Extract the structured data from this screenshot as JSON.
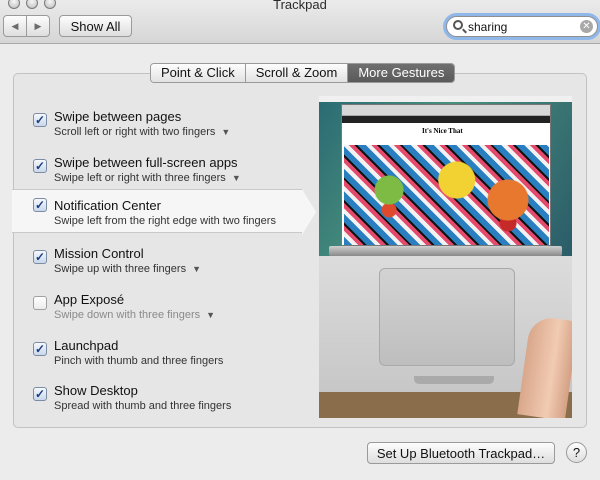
{
  "window": {
    "title": "Trackpad"
  },
  "toolbar": {
    "back": "◀",
    "forward": "▶",
    "show_all": "Show All",
    "search_value": "sharing",
    "search_clear": "✕"
  },
  "tabs": [
    {
      "label": "Point & Click",
      "active": false
    },
    {
      "label": "Scroll & Zoom",
      "active": false
    },
    {
      "label": "More Gestures",
      "active": true
    }
  ],
  "gestures": [
    {
      "title": "Swipe between pages",
      "subtitle": "Scroll left or right with two fingers",
      "checked": true,
      "dropdown": true
    },
    {
      "title": "Swipe between full-screen apps",
      "subtitle": "Swipe left or right with three fingers",
      "checked": true,
      "dropdown": true
    },
    {
      "title": "Notification Center",
      "subtitle": "Swipe left from the right edge with two fingers",
      "checked": true,
      "dropdown": false,
      "selected": true
    },
    {
      "title": "Mission Control",
      "subtitle": "Swipe up with three fingers",
      "checked": true,
      "dropdown": true
    },
    {
      "title": "App Exposé",
      "subtitle": "Swipe down with three fingers",
      "checked": false,
      "dropdown": true
    },
    {
      "title": "Launchpad",
      "subtitle": "Pinch with thumb and three fingers",
      "checked": true,
      "dropdown": false
    },
    {
      "title": "Show Desktop",
      "subtitle": "Spread with thumb and three fingers",
      "checked": true,
      "dropdown": false
    }
  ],
  "preview": {
    "site_name": "It's Nice That"
  },
  "bottom": {
    "bluetooth_button": "Set Up Bluetooth Trackpad…",
    "help": "?"
  },
  "colors": {
    "accent": "#1b3f84",
    "tab_active": "#606060",
    "search_focus": "#8fb7ea"
  }
}
